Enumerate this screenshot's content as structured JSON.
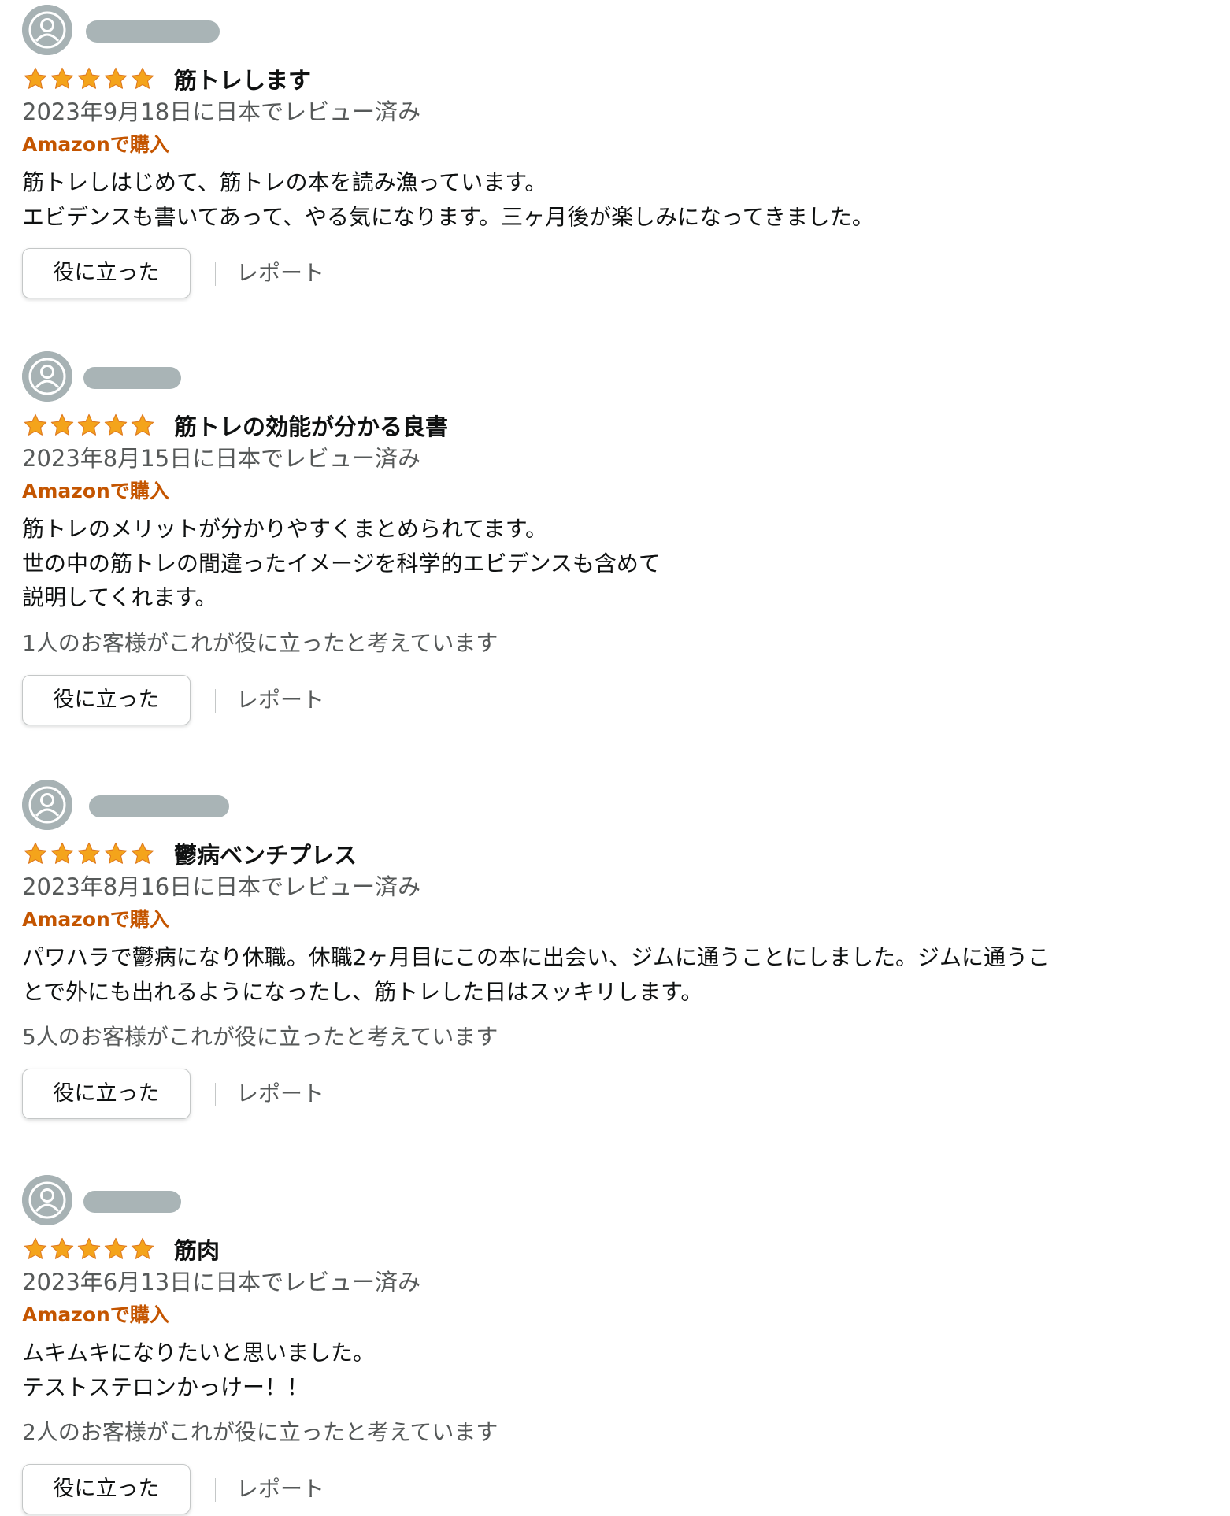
{
  "colors": {
    "star": "#f4a41b",
    "verified": "#c45500",
    "secondary_text": "#565959",
    "avatar": "#a7b2b4"
  },
  "reviews": [
    {
      "rating": 5,
      "title": "筋トレします",
      "date": "2023年9月18日に日本でレビュー済み",
      "verified": "Amazonで購入",
      "body": [
        "筋トレしはじめて、筋トレの本を読み漁っています。",
        "エビデンスも書いてあって、やる気になります。三ヶ月後が楽しみになってきました。"
      ],
      "helpful_count_text": "",
      "helpful_label": "役に立った",
      "report_label": "レポート"
    },
    {
      "rating": 5,
      "title": "筋トレの効能が分かる良書",
      "date": "2023年8月15日に日本でレビュー済み",
      "verified": "Amazonで購入",
      "body": [
        "筋トレのメリットが分かりやすくまとめられてます。",
        "世の中の筋トレの間違ったイメージを科学的エビデンスも含めて",
        "説明してくれます。"
      ],
      "helpful_count_text": "1人のお客様がこれが役に立ったと考えています",
      "helpful_label": "役に立った",
      "report_label": "レポート"
    },
    {
      "rating": 5,
      "title": "鬱病ベンチプレス",
      "date": "2023年8月16日に日本でレビュー済み",
      "verified": "Amazonで購入",
      "body": [
        "パワハラで鬱病になり休職。休職2ヶ月目にこの本に出会い、ジムに通うことにしました。ジムに通うこ",
        "とで外にも出れるようになったし、筋トレした日はスッキリします。"
      ],
      "helpful_count_text": "5人のお客様がこれが役に立ったと考えています",
      "helpful_label": "役に立った",
      "report_label": "レポート"
    },
    {
      "rating": 5,
      "title": "筋肉",
      "date": "2023年6月13日に日本でレビュー済み",
      "verified": "Amazonで購入",
      "body": [
        "ムキムキになりたいと思いました。",
        "テストステロンかっけー！！"
      ],
      "helpful_count_text": "2人のお客様がこれが役に立ったと考えています",
      "helpful_label": "役に立った",
      "report_label": "レポート"
    }
  ]
}
